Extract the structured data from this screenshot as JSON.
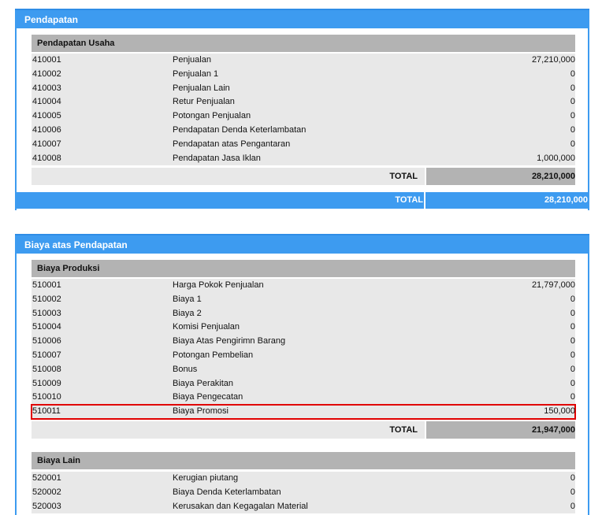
{
  "pendapatan": {
    "title": "Pendapatan",
    "group": {
      "title": "Pendapatan Usaha",
      "rows": [
        {
          "code": "410001",
          "name": "Penjualan",
          "amount": "27,210,000"
        },
        {
          "code": "410002",
          "name": "Penjualan 1",
          "amount": "0"
        },
        {
          "code": "410003",
          "name": "Penjualan Lain",
          "amount": "0"
        },
        {
          "code": "410004",
          "name": "Retur Penjualan",
          "amount": "0"
        },
        {
          "code": "410005",
          "name": "Potongan Penjualan",
          "amount": "0"
        },
        {
          "code": "410006",
          "name": "Pendapatan Denda Keterlambatan",
          "amount": "0"
        },
        {
          "code": "410007",
          "name": "Pendapatan atas Pengantaran",
          "amount": "0"
        },
        {
          "code": "410008",
          "name": "Pendapatan Jasa Iklan",
          "amount": "1,000,000"
        }
      ],
      "total_label": "TOTAL",
      "total_value": "28,210,000"
    },
    "grand_label": "TOTAL",
    "grand_value": "28,210,000"
  },
  "biaya": {
    "title": "Biaya atas Pendapatan",
    "produksi": {
      "title": "Biaya Produksi",
      "rows": [
        {
          "code": "510001",
          "name": "Harga Pokok Penjualan",
          "amount": "21,797,000"
        },
        {
          "code": "510002",
          "name": "Biaya 1",
          "amount": "0"
        },
        {
          "code": "510003",
          "name": "Biaya 2",
          "amount": "0"
        },
        {
          "code": "510004",
          "name": "Komisi Penjualan",
          "amount": "0"
        },
        {
          "code": "510006",
          "name": "Biaya Atas Pengirimn Barang",
          "amount": "0"
        },
        {
          "code": "510007",
          "name": "Potongan Pembelian",
          "amount": "0"
        },
        {
          "code": "510008",
          "name": "Bonus",
          "amount": "0"
        },
        {
          "code": "510009",
          "name": "Biaya Perakitan",
          "amount": "0"
        },
        {
          "code": "510010",
          "name": "Biaya Pengecatan",
          "amount": "0"
        },
        {
          "code": "510011",
          "name": "Biaya Promosi",
          "amount": "150,000"
        }
      ],
      "total_label": "TOTAL",
      "total_value": "21,947,000"
    },
    "lain": {
      "title": "Biaya Lain",
      "rows": [
        {
          "code": "520001",
          "name": "Kerugian piutang",
          "amount": "0"
        },
        {
          "code": "520002",
          "name": "Biaya Denda Keterlambatan",
          "amount": "0"
        },
        {
          "code": "520003",
          "name": "Kerusakan dan Kegagalan Material",
          "amount": "0"
        }
      ]
    }
  },
  "colors": {
    "header": "#3d9bf0",
    "group": "#b3b3b3",
    "row": "#e8e8e8",
    "highlight": "#e00000"
  }
}
